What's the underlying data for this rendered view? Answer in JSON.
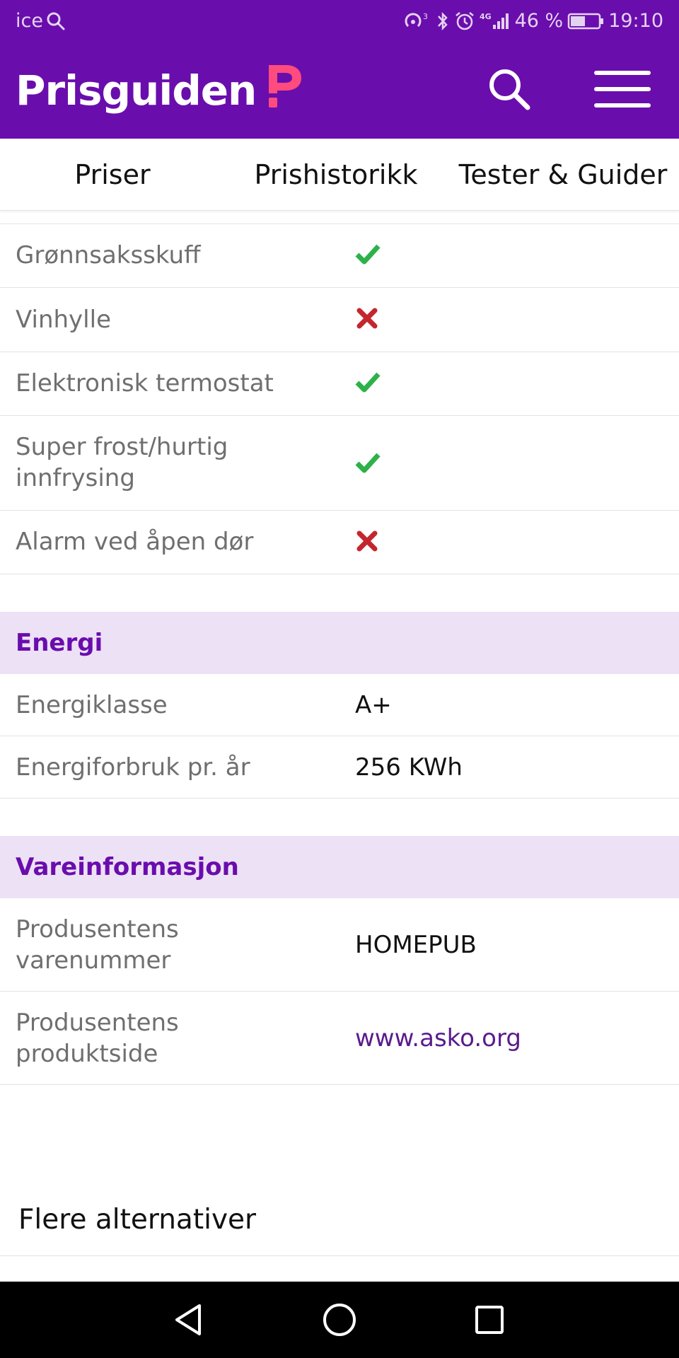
{
  "status_bar": {
    "carrier": "ice",
    "network_type": "4G",
    "battery_percent": "46 %",
    "time": "19:10"
  },
  "header": {
    "logo_text": "Prisguiden",
    "brand_color": "#6a0dad",
    "logo_accent_color": "#ff4b7d"
  },
  "tabs": [
    {
      "label": "Priser"
    },
    {
      "label": "Prishistorikk"
    },
    {
      "label": "Tester & Guider"
    }
  ],
  "feature_rows": [
    {
      "label": "Grønnsaksskuff",
      "value": "check"
    },
    {
      "label": "Vinhylle",
      "value": "cross"
    },
    {
      "label": "Elektronisk termostat",
      "value": "check"
    },
    {
      "label": "Super frost/hurtig innfrysing",
      "value": "check"
    },
    {
      "label": "Alarm ved åpen dør",
      "value": "cross"
    }
  ],
  "sections": {
    "energi": {
      "title": "Energi",
      "rows": [
        {
          "label": "Energiklasse",
          "value": "A+"
        },
        {
          "label": "Energiforbruk pr. år",
          "value": "256 KWh"
        }
      ]
    },
    "vareinformasjon": {
      "title": "Vareinformasjon",
      "rows": [
        {
          "label": "Produsentens varenummer",
          "value": "HOMEPUB"
        },
        {
          "label": "Produsentens produktside",
          "value": "www.asko.org"
        }
      ]
    }
  },
  "more_options": {
    "label": "Flere alternativer"
  },
  "colors": {
    "check": "#2db14a",
    "cross": "#c4262e",
    "section_bg": "#ede1f5",
    "link": "#5a1b8c"
  }
}
